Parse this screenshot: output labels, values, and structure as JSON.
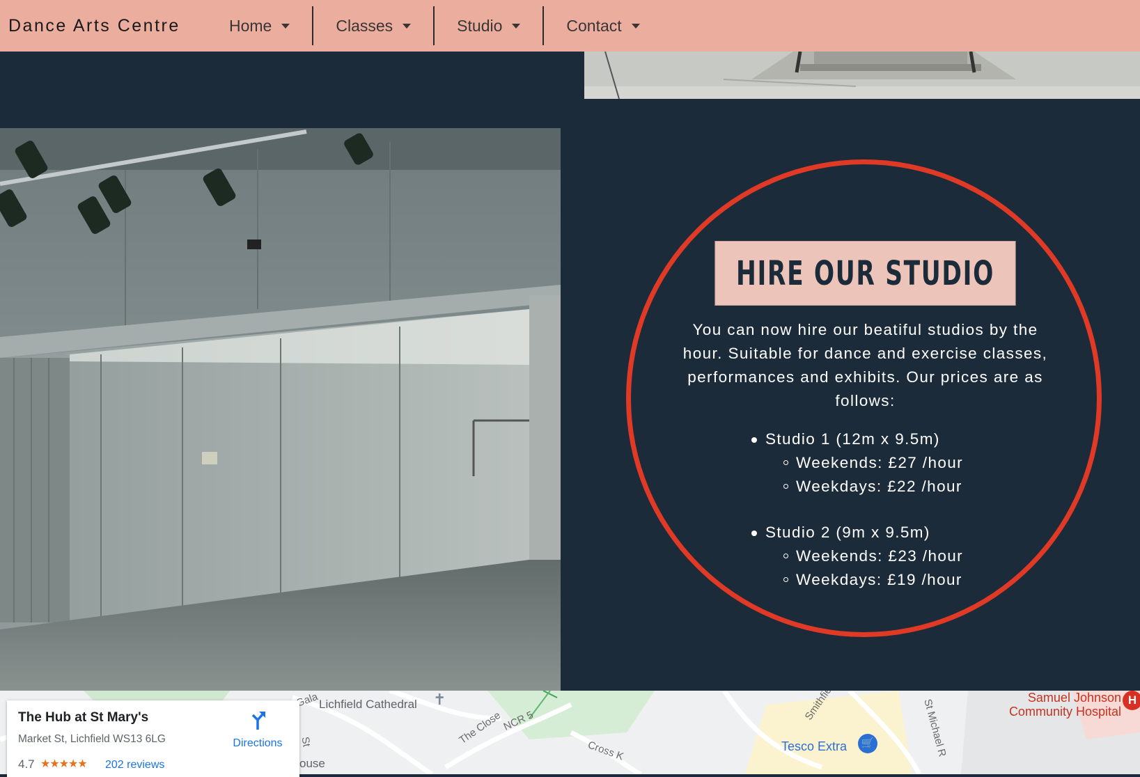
{
  "nav": {
    "brand": "Dance Arts Centre",
    "items": [
      {
        "label": "Home"
      },
      {
        "label": "Classes"
      },
      {
        "label": "Studio"
      },
      {
        "label": "Contact"
      }
    ]
  },
  "hire": {
    "title": "HIRE OUR STUDIO",
    "intro": "You can now hire our beatiful studios by the hour. Suitable for dance and exercise classes, performances and exhibits. Our prices are as follows:",
    "studios": [
      {
        "name": "Studio 1 (12m x 9.5m)",
        "weekends": "Weekends: £27 /hour",
        "weekdays": "Weekdays: £22 /hour"
      },
      {
        "name": "Studio 2 (9m x 9.5m)",
        "weekends": "Weekends: £23 /hour",
        "weekdays": "Weekdays: £19 /hour"
      }
    ]
  },
  "map": {
    "place_name": "The Hub at St Mary's",
    "address": "Market St, Lichfield WS13 6LG",
    "rating": "4.7",
    "stars": "★★★★★",
    "reviews": "202 reviews",
    "directions": "Directions",
    "labels": {
      "cathedral": "Lichfield Cathedral",
      "tesco": "Tesco Extra",
      "hospital_1": "Samuel Johnson",
      "hospital_2": "Community Hospital",
      "the_close": "The Close",
      "ncr5": "NCR 5",
      "cross": "Cross K",
      "smithfield": "Smithfie",
      "st_michael": "St Michael R",
      "gala": "Gala",
      "st": "St",
      "house": "ouse"
    }
  },
  "colors": {
    "navbar": "#ebae9e",
    "page_background": "#1c2b3a",
    "title_box": "#ecc4b9",
    "circle_accent": "#e03a26"
  }
}
